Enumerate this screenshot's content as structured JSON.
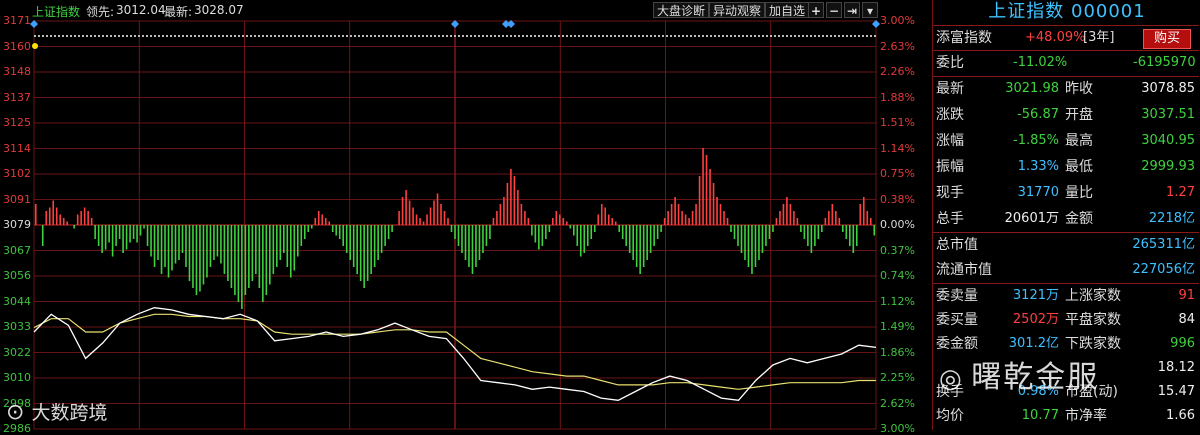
{
  "header": {
    "index_name": "上证指数",
    "leader_label": "领先:",
    "leader_value": "3012.04",
    "latest_label": "最新:",
    "latest_value": "3028.07",
    "buttons": [
      "大盘诊断",
      "异动观察",
      "加自选"
    ],
    "icon_buttons": [
      "plus-icon",
      "minus-icon",
      "next-icon",
      "dropdown-icon"
    ],
    "icon_glyphs": [
      "+",
      "−",
      "⇥",
      "▾"
    ]
  },
  "left_axis": [
    "3171",
    "3160",
    "3148",
    "3137",
    "3125",
    "3114",
    "3102",
    "3091",
    "3079",
    "3067",
    "3056",
    "3044",
    "3033",
    "3022",
    "3010",
    "2998",
    "2986"
  ],
  "right_axis": [
    "3.00%",
    "2.63%",
    "2.26%",
    "1.88%",
    "1.51%",
    "1.14%",
    "0.75%",
    "0.38%",
    "0.00%",
    "0.37%",
    "0.74%",
    "1.12%",
    "1.49%",
    "1.86%",
    "2.25%",
    "2.62%",
    "3.00%"
  ],
  "colors": {
    "up": "#ff4040",
    "down": "#3fd23f",
    "grid": "#8a1a1a",
    "price_line": "#ffffff",
    "avg_line": "#e8e070",
    "accent": "#3fc0ff"
  },
  "panel": {
    "title": "上证指数 000001",
    "tianfu_label": "添富指数",
    "tianfu_value": "+48.09%",
    "tianfu_period": "[3年]",
    "buy_label": "购买",
    "weibi_label": "委比",
    "weibi_value": "-11.02%",
    "weicha_value": "-6195970",
    "stats": [
      {
        "l1": "最新",
        "v1": "3021.98",
        "c1": "green",
        "l2": "昨收",
        "v2": "3078.85",
        "c2": "white"
      },
      {
        "l1": "涨跌",
        "v1": "-56.87",
        "c1": "green",
        "l2": "开盘",
        "v2": "3037.51",
        "c2": "green"
      },
      {
        "l1": "涨幅",
        "v1": "-1.85%",
        "c1": "green",
        "l2": "最高",
        "v2": "3040.95",
        "c2": "green"
      },
      {
        "l1": "振幅",
        "v1": "1.33%",
        "c1": "cyan",
        "l2": "最低",
        "v2": "2999.93",
        "c2": "green"
      },
      {
        "l1": "现手",
        "v1": "31770",
        "c1": "cyan",
        "l2": "量比",
        "v2": "1.27",
        "c2": "red"
      },
      {
        "l1": "总手",
        "v1": "20601万",
        "c1": "white",
        "l2": "金额",
        "v2": "2218亿",
        "c2": "cyan"
      }
    ],
    "mcap": [
      {
        "label": "总市值",
        "value": "265311亿"
      },
      {
        "label": "流通市值",
        "value": "227056亿"
      }
    ],
    "orders": [
      {
        "l1": "委卖量",
        "v1": "3121万",
        "c1": "cyan",
        "l2": "上涨家数",
        "v2": "91",
        "c2": "red"
      },
      {
        "l1": "委买量",
        "v1": "2502万",
        "c1": "red",
        "l2": "平盘家数",
        "v2": "84",
        "c2": "white"
      },
      {
        "l1": "委金额",
        "v1": "301.2亿",
        "c1": "cyan",
        "l2": "下跌家数",
        "v2": "996",
        "c2": "green"
      },
      {
        "l1": "",
        "v1": "",
        "c1": "white",
        "l2": "",
        "v2": "18.12",
        "c2": "white"
      },
      {
        "l1": "换手",
        "v1": "0.98%",
        "c1": "cyan",
        "l2": "市盈(动)",
        "v2": "15.47",
        "c2": "white"
      },
      {
        "l1": "均价",
        "v1": "10.77",
        "c1": "green",
        "l2": "市净率",
        "v2": "1.66",
        "c2": "white"
      }
    ]
  },
  "watermarks": {
    "left_text": "大数跨境",
    "right_text": "曙乾金服"
  },
  "chart_data": {
    "type": "line",
    "title": "上证指数",
    "y_axis_left_range": [
      2986,
      3171
    ],
    "y_axis_right_label": "percent change",
    "prev_close": 3078.85,
    "price": [
      3030,
      3038,
      3033,
      3018,
      3025,
      3034,
      3038,
      3041,
      3040,
      3038,
      3037,
      3036,
      3038,
      3035,
      3026,
      3027,
      3028,
      3030,
      3028,
      3029,
      3031,
      3034,
      3031,
      3028,
      3027,
      3018,
      3008,
      3007,
      3006,
      3004,
      3005,
      3004,
      3003,
      3000,
      2999,
      3003,
      3007,
      3010,
      3008,
      3004,
      3000,
      2999,
      3008,
      3015,
      3018,
      3016,
      3018,
      3020,
      3024,
      3023
    ],
    "avg": [
      3032,
      3036,
      3036,
      3030,
      3030,
      3034,
      3036,
      3038,
      3038,
      3037,
      3037,
      3036,
      3036,
      3035,
      3030,
      3029,
      3029,
      3029,
      3029,
      3029,
      3030,
      3031,
      3031,
      3030,
      3030,
      3024,
      3018,
      3016,
      3014,
      3012,
      3011,
      3010,
      3010,
      3008,
      3006,
      3006,
      3006,
      3007,
      3007,
      3006,
      3005,
      3004,
      3005,
      3006,
      3007,
      3007,
      3007,
      3007,
      3008,
      3008
    ],
    "flow_bars": [
      6,
      0,
      -6,
      4,
      5,
      7,
      5,
      3,
      2,
      1,
      0,
      -1,
      3,
      4,
      5,
      4,
      2,
      -4,
      -6,
      -8,
      -7,
      -5,
      -9,
      -6,
      -4,
      -8,
      -7,
      -5,
      -4,
      -5,
      -3,
      -1,
      -6,
      -9,
      -12,
      -10,
      -14,
      -12,
      -15,
      -13,
      -11,
      -10,
      -8,
      -12,
      -16,
      -18,
      -20,
      -19,
      -17,
      -15,
      -12,
      -10,
      -9,
      -11,
      -14,
      -16,
      -18,
      -20,
      -22,
      -24,
      -20,
      -18,
      -16,
      -14,
      -18,
      -22,
      -20,
      -17,
      -14,
      -12,
      -10,
      -8,
      -12,
      -15,
      -13,
      -9,
      -6,
      -4,
      -2,
      -1,
      2,
      4,
      3,
      2,
      1,
      -2,
      -3,
      -4,
      -6,
      -8,
      -10,
      -12,
      -14,
      -16,
      -18,
      -16,
      -14,
      -12,
      -10,
      -8,
      -6,
      -4,
      -2,
      0,
      4,
      8,
      10,
      7,
      5,
      3,
      2,
      1,
      3,
      5,
      7,
      9,
      6,
      4,
      2,
      -2,
      -4,
      -6,
      -8,
      -10,
      -12,
      -14,
      -12,
      -10,
      -8,
      -6,
      -4,
      2,
      4,
      6,
      8,
      12,
      16,
      14,
      10,
      6,
      4,
      2,
      -3,
      -5,
      -7,
      -6,
      -4,
      -2,
      2,
      4,
      3,
      2,
      1,
      -1,
      -3,
      -6,
      -9,
      -8,
      -6,
      -4,
      -2,
      3,
      6,
      5,
      3,
      2,
      1,
      -2,
      -4,
      -6,
      -8,
      -10,
      -12,
      -14,
      -12,
      -10,
      -8,
      -6,
      -4,
      -2,
      2,
      4,
      6,
      8,
      6,
      4,
      3,
      2,
      4,
      6,
      14,
      22,
      20,
      16,
      12,
      8,
      6,
      4,
      2,
      -2,
      -4,
      -6,
      -8,
      -10,
      -12,
      -14,
      -12,
      -10,
      -8,
      -6,
      -4,
      -2,
      2,
      4,
      6,
      8,
      6,
      4,
      2,
      -2,
      -4,
      -6,
      -8,
      -6,
      -4,
      -2,
      2,
      4,
      6,
      4,
      2,
      -2,
      -4,
      -6,
      -8,
      -6,
      6,
      8,
      4,
      2,
      -3
    ]
  }
}
